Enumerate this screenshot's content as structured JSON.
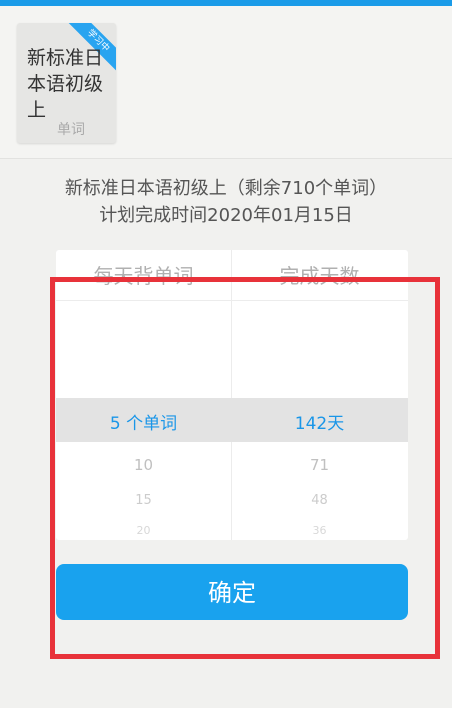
{
  "book": {
    "badge": "学习中",
    "cover_title": "新标准日本语初级上",
    "cover_subtitle": "单词"
  },
  "info": {
    "title": "新标准日本语初级上（剩余710个单词）",
    "plan": "计划完成时间2020年01月15日"
  },
  "picker": {
    "left_header": "每天背单词",
    "right_header": "完成天数",
    "selected": {
      "words": "5  个单词",
      "days": "142天"
    },
    "left_options": [
      "10",
      "15",
      "20"
    ],
    "right_options": [
      "71",
      "48",
      "36"
    ]
  },
  "confirm_label": "确定",
  "colors": {
    "accent": "#19a2ee",
    "highlight": "#e8323a"
  }
}
